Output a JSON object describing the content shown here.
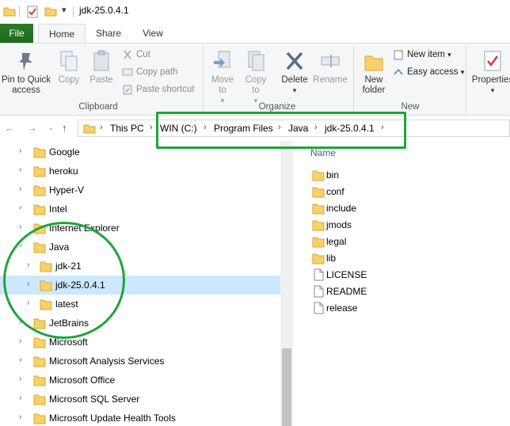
{
  "window": {
    "title": "jdk-25.0.4.1",
    "quick_access_dropdown": "▾"
  },
  "tabs": [
    {
      "label": "File"
    },
    {
      "label": "Home"
    },
    {
      "label": "Share"
    },
    {
      "label": "View"
    }
  ],
  "ribbon": {
    "clipboard": {
      "label": "Clipboard",
      "pin_label": "Pin to Quick access",
      "copy_label": "Copy",
      "paste_label": "Paste",
      "cut_label": "Cut",
      "copy_path_label": "Copy path",
      "paste_shortcut_label": "Paste shortcut"
    },
    "organize": {
      "label": "Organize",
      "move_to_label": "Move to",
      "copy_to_label": "Copy to",
      "delete_label": "Delete",
      "rename_label": "Rename"
    },
    "new": {
      "label": "New",
      "new_folder_label": "New folder",
      "new_item_label": "New item",
      "easy_access_label": "Easy access"
    },
    "open": {
      "properties_label": "Properties"
    }
  },
  "address": {
    "crumbs": [
      "This PC",
      "WIN (C:)",
      "Program Files",
      "Java",
      "jdk-25.0.4.1"
    ]
  },
  "navpane": {
    "items": [
      {
        "label": "Google"
      },
      {
        "label": "heroku"
      },
      {
        "label": "Hyper-V"
      },
      {
        "label": "Intel"
      },
      {
        "label": "Internet Explorer"
      },
      {
        "label": "Java"
      },
      {
        "label": "jdk-21"
      },
      {
        "label": "jdk-25.0.4.1"
      },
      {
        "label": "latest"
      },
      {
        "label": "JetBrains"
      },
      {
        "label": "Microsoft"
      },
      {
        "label": "Microsoft Analysis Services"
      },
      {
        "label": "Microsoft Office"
      },
      {
        "label": "Microsoft SQL Server"
      },
      {
        "label": "Microsoft Update Health Tools"
      }
    ]
  },
  "filepane": {
    "column_name": "Name",
    "items": [
      {
        "label": "bin",
        "type": "folder"
      },
      {
        "label": "conf",
        "type": "folder"
      },
      {
        "label": "include",
        "type": "folder"
      },
      {
        "label": "jmods",
        "type": "folder"
      },
      {
        "label": "legal",
        "type": "folder"
      },
      {
        "label": "lib",
        "type": "folder"
      },
      {
        "label": "LICENSE",
        "type": "file"
      },
      {
        "label": "README",
        "type": "file"
      },
      {
        "label": "release",
        "type": "file"
      }
    ]
  },
  "colors": {
    "file_tab": "#1d6a1d",
    "selection": "#cce8ff",
    "folder": "#f7d16a",
    "annotation": "#1ea53a"
  }
}
